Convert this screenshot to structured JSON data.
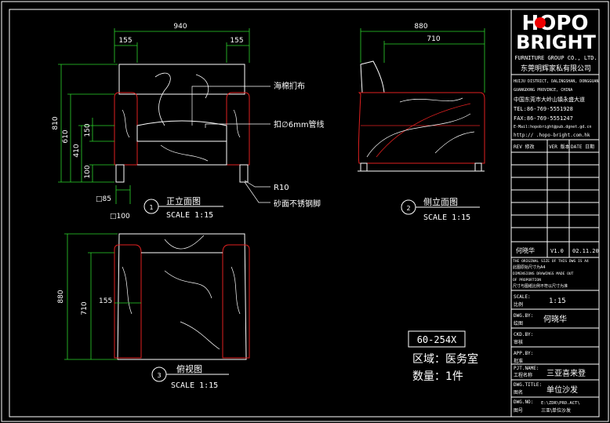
{
  "company": {
    "logo_top": "HOPO",
    "logo_bottom": "BRIGHT",
    "group_en": "FURNITURE GROUP CO., LTD.",
    "name_cn": "东莞明辉家私有限公司",
    "addr_en1": "HUIJU DISTRICT, DALINGSHAN, DONGGUAN",
    "addr_en2": "GUANGDONG PROVINCE, CHINA",
    "addr_cn": "中国东莞市大岭山镇永盛大道",
    "tel": "TEL:86-769-5551928",
    "fax": "FAX:86-769-5551247",
    "email": "E-Mail:hopobright@pub.dgnet.gd.cn",
    "web": "http://   .hopo-bright.com.hk"
  },
  "revision_header": {
    "rev": "REV 修改",
    "version": "VER 版本",
    "date": "DATE 日期"
  },
  "revision_row": {
    "name": "何晓华",
    "version": "V1.0",
    "date": "02.11.20"
  },
  "notice": {
    "l1": "THE ORIGINAL SIZE OF THIS DWG IS A4",
    "l2": "此图原始尺寸为A4",
    "l3": "DIMENSIONS DRAWINGS MADE OUT",
    "l4": "OF PROPORTION",
    "l5": "尺寸与图纸比例不符以尺寸为准"
  },
  "title_block": {
    "scale_label": "SCALE:",
    "scale_cn": "比例",
    "scale_value": "1:15",
    "drawn_label": "DWG.BY:",
    "drawn_cn": "绘图",
    "drawn_value": "何晓华",
    "checked_label": "CKD.BY:",
    "checked_cn": "审核",
    "approved_label": "APP.BY:",
    "approved_cn": "批准",
    "project_label": "PJT.NAME:",
    "project_cn": "工程名称",
    "project_value": "三亚喜来登",
    "title_label": "DWG.TITLE:",
    "title_cn": "图名",
    "title_value": "单位沙发",
    "number_label": "DWG.NO:",
    "number_cn": "图号",
    "number_value": "E:\\ZDR\\PRO.ACT\\",
    "number_value2": "三亚\\单位沙发"
  },
  "front_view": {
    "title": "正立面图",
    "scale": "SCALE 1:15",
    "index": "1",
    "dim_width": "940",
    "dim_arm_left": "155",
    "dim_arm_right": "155",
    "dim_h_total": "810",
    "dim_h_back": "610",
    "dim_h_seat": "410",
    "dim_h_cushion": "150",
    "dim_h_leg": "100",
    "leg_section": "□85",
    "leg_section2": "□100",
    "note_fabric": "海棉扪布",
    "note_tube": "扣∅6mm管线",
    "note_r": "R10",
    "note_leg": "砂面不锈钢脚"
  },
  "side_view": {
    "title": "侧立面图",
    "scale": "SCALE 1:15",
    "index": "2",
    "dim_depth": "880",
    "dim_depth_inner": "710"
  },
  "top_view": {
    "title": "俯视图",
    "scale": "SCALE 1:15",
    "index": "3",
    "dim_depth": "880",
    "dim_depth_inner": "710",
    "dim_arm": "155"
  },
  "info": {
    "code": "60-254X",
    "area": "区域：医务室",
    "qty": "数量：1件"
  }
}
